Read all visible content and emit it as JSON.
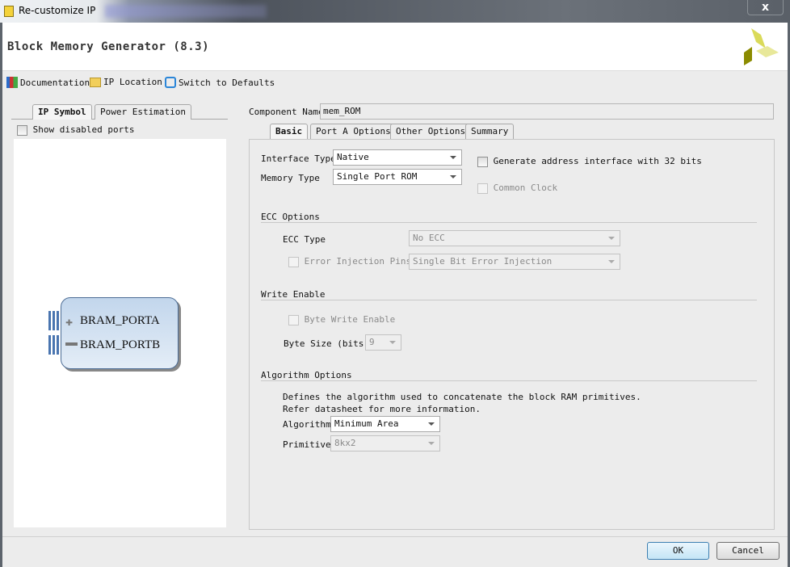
{
  "window": {
    "title": "Re-customize IP",
    "close_label": "x"
  },
  "header": {
    "title": "Block Memory Generator (8.3)"
  },
  "toolbar": {
    "documentation": "Documentation",
    "ip_location": "IP Location",
    "switch_defaults": "Switch to Defaults"
  },
  "left": {
    "tabs": [
      "IP Symbol",
      "Power Estimation"
    ],
    "show_disabled_ports": "Show disabled ports",
    "ports": [
      "BRAM_PORTA",
      "BRAM_PORTB"
    ]
  },
  "right": {
    "component_name_label": "Component Name",
    "component_name_value": "mem_ROM",
    "tabs": [
      "Basic",
      "Port A Options",
      "Other Options",
      "Summary"
    ],
    "interface_type_label": "Interface Type",
    "interface_type_value": "Native",
    "memory_type_label": "Memory Type",
    "memory_type_value": "Single Port ROM",
    "gen_addr_32": "Generate address interface with 32 bits",
    "common_clock": "Common Clock",
    "ecc_section": "ECC Options",
    "ecc_type_label": "ECC Type",
    "ecc_type_value": "No ECC",
    "error_injection_label": "Error Injection Pins",
    "error_injection_value": "Single Bit Error Injection",
    "write_enable_section": "Write Enable",
    "byte_write_enable": "Byte Write Enable",
    "byte_size_label": "Byte Size (bits)",
    "byte_size_value": "9",
    "algorithm_section": "Algorithm Options",
    "algo_desc_1": "Defines the algorithm used to concatenate the block RAM primitives.",
    "algo_desc_2": "Refer datasheet for more information.",
    "algorithm_label": "Algorithm",
    "algorithm_value": "Minimum Area",
    "primitive_label": "Primitive",
    "primitive_value": "8kx2"
  },
  "footer": {
    "ok": "OK",
    "cancel": "Cancel"
  }
}
